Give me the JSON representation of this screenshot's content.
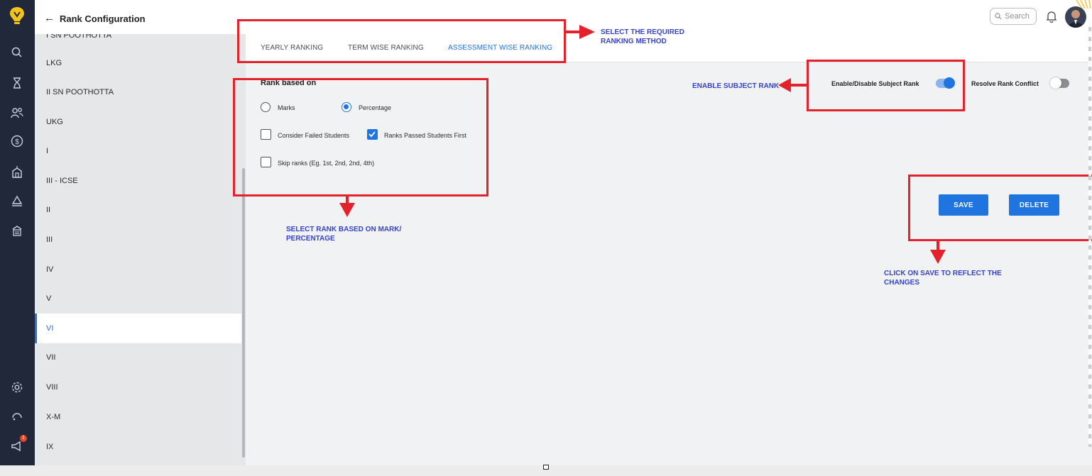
{
  "header": {
    "title": "Rank Configuration",
    "search_placeholder": "Search"
  },
  "sidebar": {
    "clipped_item": "I SN POOTHOTTA",
    "items": [
      "LKG",
      "II SN POOTHOTTA",
      "UKG",
      "I",
      "III - ICSE",
      "II",
      "III",
      "IV",
      "V",
      "VI",
      "VII",
      "VIII",
      "X-M",
      "IX"
    ],
    "active": "VI"
  },
  "tabs": [
    "YEARLY RANKING",
    "TERM WISE RANKING",
    "ASSESSMENT WISE RANKING"
  ],
  "active_tab": "ASSESSMENT WISE RANKING",
  "rank_based_on": {
    "title": "Rank based on",
    "option_marks": "Marks",
    "option_percentage": "Percentage",
    "selected": "Percentage"
  },
  "options": {
    "consider_failed": {
      "label": "Consider Failed Students",
      "checked": false
    },
    "passed_first": {
      "label": "Ranks Passed Students First",
      "checked": true
    },
    "skip_ranks": {
      "label": "Skip ranks (Eg. 1st, 2nd, 2nd, 4th)",
      "checked": false
    }
  },
  "toggles": {
    "subject_rank": {
      "label": "Enable/Disable Subject Rank",
      "on": true
    },
    "rank_conflict": {
      "label": "Resolve Rank Conflict",
      "on": false
    }
  },
  "buttons": {
    "save": "SAVE",
    "delete": "DELETE"
  },
  "annotations": {
    "ranking_method_1": "SELECT THE REQUIRED",
    "ranking_method_2": "RANKING METHOD",
    "subject_rank": "ENABLE SUBJECT RANK",
    "rank_based_1": "SELECT RANK BASED ON MARK/",
    "rank_based_2": "PERCENTAGE",
    "save_1": "CLICK ON SAVE TO REFLECT THE",
    "save_2": "CHANGES"
  },
  "badges": {
    "notifications": "1"
  },
  "colors": {
    "accent": "#1f74e0",
    "annotation_red": "#e4222b",
    "annotation_text": "#3542c9",
    "rail": "#20283a"
  }
}
